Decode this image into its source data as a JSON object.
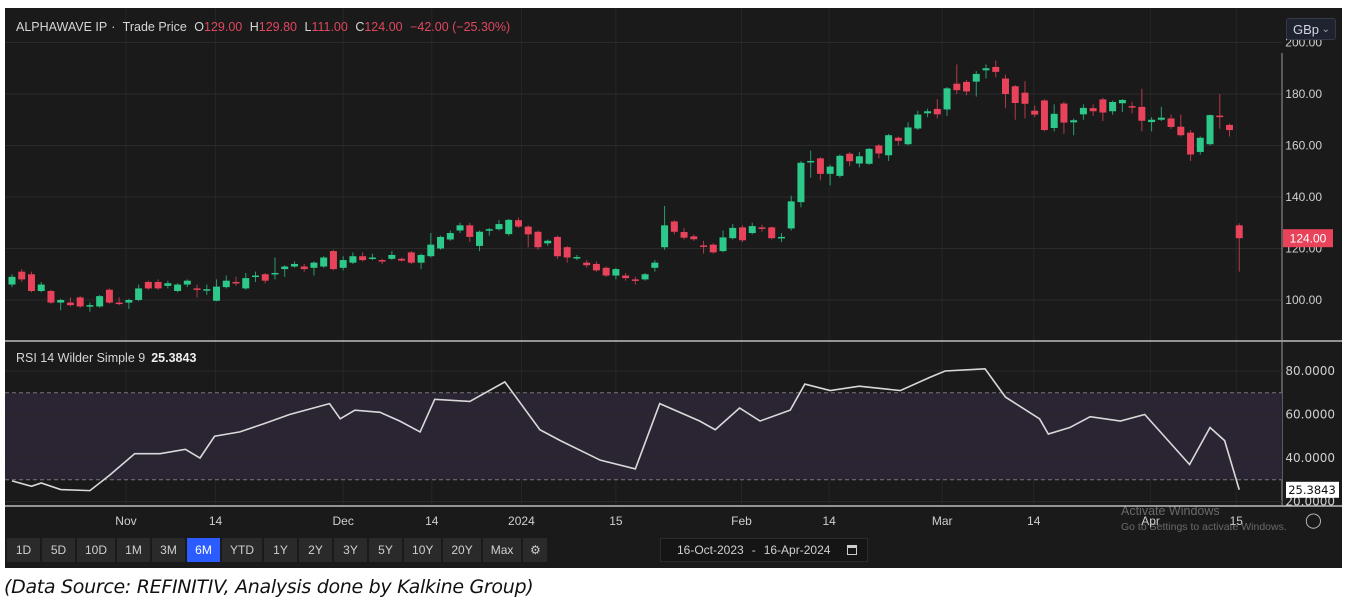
{
  "legend": {
    "instrument": "ALPHAWAVE IP",
    "series": "Trade Price",
    "open_label": "O",
    "open": "129.00",
    "high_label": "H",
    "high": "129.80",
    "low_label": "L",
    "low": "111.00",
    "close_label": "C",
    "close": "124.00",
    "change": "−42.00 (−25.30%)"
  },
  "currency": "GBp",
  "colors": {
    "up": "#2dc98a",
    "down": "#e8435a",
    "rsi": "#d9d9d9",
    "band": "#2a2433",
    "active": "#2b5cff"
  },
  "price_axis": {
    "ticks": [
      100,
      120,
      140,
      160,
      180,
      200
    ],
    "labels": [
      "100.00",
      "120.00",
      "140.00",
      "160.00",
      "180.00",
      "200.00"
    ],
    "range": [
      100,
      200
    ],
    "last_price_label": "124.00",
    "last_price": 124
  },
  "candles": [
    [
      106,
      110,
      105,
      109
    ],
    [
      111,
      112,
      107,
      108
    ],
    [
      110,
      111,
      103,
      103.5
    ],
    [
      103.5,
      107,
      103,
      106
    ],
    [
      103.5,
      104,
      98.5,
      99
    ],
    [
      99,
      100.5,
      96,
      100
    ],
    [
      99,
      101,
      97.5,
      98
    ],
    [
      101,
      101.5,
      97,
      97.5
    ],
    [
      97.5,
      99,
      95.5,
      98
    ],
    [
      97.5,
      102,
      97,
      101.5
    ],
    [
      104,
      104.5,
      98.5,
      99
    ],
    [
      99,
      101,
      98,
      98.5
    ],
    [
      99,
      100.5,
      96.5,
      100
    ],
    [
      100,
      106,
      99.5,
      104.5
    ],
    [
      107,
      107.5,
      104,
      104.5
    ],
    [
      107,
      108,
      104,
      104.5
    ],
    [
      105.5,
      107.5,
      104.5,
      106.5
    ],
    [
      103.5,
      106.5,
      103,
      106
    ],
    [
      106,
      108,
      105,
      107.5
    ],
    [
      104.5,
      106,
      101,
      104
    ],
    [
      104,
      106,
      102,
      104.2
    ],
    [
      99.7,
      108,
      99.5,
      105.2
    ],
    [
      105,
      109.5,
      104.5,
      107.5
    ],
    [
      107,
      109,
      105.5,
      106.5
    ],
    [
      104.5,
      110.5,
      104,
      108.5
    ],
    [
      109,
      111,
      107,
      109.5
    ],
    [
      110,
      110.5,
      106.5,
      107.5
    ],
    [
      110.3,
      116.5,
      108,
      110.5
    ],
    [
      112,
      113.5,
      109,
      113
    ],
    [
      113,
      115,
      112.5,
      114
    ],
    [
      113,
      114,
      111,
      112
    ],
    [
      112.5,
      115,
      109.5,
      114.5
    ],
    [
      113,
      117,
      112.5,
      116.5
    ],
    [
      119,
      119.5,
      111.5,
      112
    ],
    [
      112.5,
      117,
      111.5,
      115.5
    ],
    [
      114.5,
      118.5,
      114,
      117
    ],
    [
      117,
      118.5,
      115,
      115.5
    ],
    [
      116,
      118,
      115.5,
      116.5
    ],
    [
      115.5,
      116,
      114,
      115
    ],
    [
      116,
      119,
      115.5,
      117.5
    ],
    [
      116,
      116.5,
      115,
      115.3
    ],
    [
      118.5,
      119,
      114,
      114.5
    ],
    [
      114.5,
      118,
      112,
      117.5
    ],
    [
      117,
      126,
      116.5,
      121.5
    ],
    [
      120,
      125,
      119.5,
      124.5
    ],
    [
      123.5,
      127,
      123,
      126
    ],
    [
      127,
      130,
      126,
      129
    ],
    [
      129,
      130,
      122.5,
      124.5
    ],
    [
      121,
      127,
      119,
      126.5
    ],
    [
      127,
      128,
      125,
      127.5
    ],
    [
      127.5,
      131,
      127,
      129.5
    ],
    [
      125.6,
      131.5,
      125,
      131.1
    ],
    [
      131,
      132,
      128,
      128.5
    ],
    [
      128.5,
      129,
      120.5,
      125.5
    ],
    [
      126.5,
      127,
      119.5,
      120.5
    ],
    [
      122,
      123.5,
      121,
      123
    ],
    [
      124.5,
      125,
      116,
      117
    ],
    [
      120.5,
      121,
      114.5,
      116.5
    ],
    [
      116.5,
      117.5,
      115.5,
      116.7
    ],
    [
      114.5,
      115.5,
      112.5,
      113.5
    ],
    [
      114,
      115,
      111,
      111.5
    ],
    [
      112.5,
      113,
      109,
      109.5
    ],
    [
      109.5,
      112.5,
      108,
      112
    ],
    [
      109.5,
      110.5,
      107.5,
      108.5
    ],
    [
      108,
      109,
      106,
      107.5
    ],
    [
      108,
      110.5,
      107.5,
      110
    ],
    [
      112.5,
      115.5,
      111,
      114.5
    ],
    [
      120.5,
      136.5,
      119.5,
      129
    ],
    [
      130.5,
      131,
      125.5,
      126.5
    ],
    [
      126.4,
      128,
      123.5,
      124.2
    ],
    [
      124.7,
      125.5,
      123,
      123.6
    ],
    [
      121.2,
      123,
      118,
      121
    ],
    [
      121.5,
      122,
      118,
      118.5
    ],
    [
      119,
      127,
      118.5,
      124.3
    ],
    [
      124,
      129.5,
      123.5,
      128
    ],
    [
      128.2,
      129,
      122.5,
      123.2
    ],
    [
      126,
      130,
      125.5,
      128.7
    ],
    [
      128.2,
      129.2,
      126.5,
      128
    ],
    [
      128.2,
      128.5,
      123.5,
      124
    ],
    [
      124.2,
      126,
      122.5,
      124.5
    ],
    [
      127.8,
      140.5,
      127,
      138.3
    ],
    [
      138,
      154,
      136,
      153.3
    ],
    [
      153.8,
      158,
      147.5,
      154
    ],
    [
      155,
      155.5,
      146.5,
      149
    ],
    [
      149,
      152.5,
      144.5,
      151.8
    ],
    [
      148.2,
      156.5,
      147.5,
      156
    ],
    [
      156.8,
      157.5,
      152,
      153.9
    ],
    [
      153,
      157.5,
      151.5,
      155.8
    ],
    [
      152.9,
      159,
      152.5,
      158.7
    ],
    [
      160,
      160.5,
      155,
      156.9
    ],
    [
      156.2,
      164.5,
      154,
      164
    ],
    [
      163,
      163.5,
      160,
      161.8
    ],
    [
      160.5,
      169,
      160,
      167
    ],
    [
      166.6,
      173.5,
      166,
      172
    ],
    [
      172.5,
      174.3,
      171,
      173.3
    ],
    [
      174.2,
      178,
      170.5,
      172.1
    ],
    [
      174,
      182.7,
      171.5,
      182.2
    ],
    [
      184,
      191.5,
      180,
      181.5
    ],
    [
      184.7,
      185.5,
      179.5,
      181
    ],
    [
      184.8,
      189,
      179,
      187.8
    ],
    [
      189.2,
      191.5,
      186,
      190
    ],
    [
      190.5,
      193,
      186.5,
      188.6
    ],
    [
      186,
      187.5,
      174.5,
      180
    ],
    [
      183,
      183.5,
      170,
      176.5
    ],
    [
      180.5,
      185,
      170.5,
      176.2
    ],
    [
      173.5,
      175.5,
      171,
      172
    ],
    [
      177.5,
      178,
      165.5,
      166
    ],
    [
      166.8,
      176,
      165.5,
      172.3
    ],
    [
      176.3,
      177,
      164.5,
      168.9
    ],
    [
      169,
      170.5,
      164,
      169.8
    ],
    [
      172.1,
      176,
      170,
      174.6
    ],
    [
      174.5,
      176,
      171.5,
      173.3
    ],
    [
      177.9,
      178.5,
      169.5,
      172.8
    ],
    [
      173.3,
      177.5,
      172,
      176.9
    ],
    [
      176.4,
      178,
      173,
      177.7
    ],
    [
      175.3,
      177,
      172.5,
      175.1
    ],
    [
      175,
      182,
      165.5,
      169.6
    ],
    [
      169.1,
      171,
      165.5,
      170
    ],
    [
      170,
      175,
      169.5,
      170.8
    ],
    [
      170.5,
      172,
      166.5,
      167.2
    ],
    [
      167.3,
      172,
      163.5,
      164
    ],
    [
      165,
      166,
      154,
      156.5
    ],
    [
      157.5,
      163.5,
      156.5,
      163
    ],
    [
      160.5,
      172,
      160,
      171.8
    ],
    [
      171.6,
      180,
      166.5,
      171.4
    ],
    [
      168,
      168.5,
      163.5,
      166
    ],
    [
      129,
      129.8,
      111,
      124
    ]
  ],
  "rsi": {
    "label": "RSI 14 Wilder Simple 9",
    "value": "25.3843",
    "axis_labels": [
      "20.0000",
      "40.0000",
      "60.0000",
      "80.0000"
    ],
    "axis_ticks": [
      20,
      40,
      60,
      80
    ],
    "band": [
      30,
      70
    ],
    "points": [
      [
        0,
        29.5
      ],
      [
        2,
        27
      ],
      [
        3,
        28.5
      ],
      [
        5,
        25.5
      ],
      [
        8,
        25
      ],
      [
        10,
        32
      ],
      [
        12.6,
        42
      ],
      [
        15.2,
        42
      ],
      [
        17.8,
        44
      ],
      [
        19.3,
        40
      ],
      [
        20.8,
        50
      ],
      [
        23.4,
        52
      ],
      [
        26,
        56
      ],
      [
        28.5,
        60
      ],
      [
        32.6,
        65
      ],
      [
        33.7,
        58
      ],
      [
        35.2,
        62
      ],
      [
        37.8,
        61
      ],
      [
        39.8,
        57
      ],
      [
        41.9,
        52
      ],
      [
        43.4,
        67
      ],
      [
        47,
        66
      ],
      [
        50.6,
        75
      ],
      [
        54.2,
        53
      ],
      [
        56.3,
        48
      ],
      [
        60.4,
        39
      ],
      [
        64,
        35
      ],
      [
        66.5,
        65
      ],
      [
        70.6,
        57
      ],
      [
        72.2,
        53
      ],
      [
        74.7,
        63
      ],
      [
        76.8,
        57
      ],
      [
        79.9,
        62
      ],
      [
        81.4,
        74
      ],
      [
        84,
        71
      ],
      [
        87,
        73
      ],
      [
        91.2,
        71
      ],
      [
        94.2,
        77
      ],
      [
        95.8,
        80
      ],
      [
        99.9,
        81
      ],
      [
        102,
        68
      ],
      [
        105.5,
        58
      ],
      [
        106.4,
        51
      ],
      [
        108.6,
        54
      ],
      [
        110.7,
        59
      ],
      [
        113.8,
        57
      ],
      [
        116.3,
        60
      ],
      [
        117.9,
        52
      ],
      [
        120.9,
        37
      ],
      [
        123,
        54
      ],
      [
        124.5,
        48
      ],
      [
        126,
        25.3843
      ]
    ]
  },
  "x_axis": {
    "labels": [
      {
        "text": "Nov",
        "i": 11.7
      },
      {
        "text": "14",
        "i": 20.9
      },
      {
        "text": "Dec",
        "i": 34
      },
      {
        "text": "14",
        "i": 43.1
      },
      {
        "text": "2024",
        "i": 52.3
      },
      {
        "text": "15",
        "i": 62
      },
      {
        "text": "Feb",
        "i": 74.9
      },
      {
        "text": "14",
        "i": 83.9
      },
      {
        "text": "Mar",
        "i": 95.5
      },
      {
        "text": "14",
        "i": 104.9
      },
      {
        "text": "Apr",
        "i": 116.9
      },
      {
        "text": "15",
        "i": 125.7
      }
    ]
  },
  "toolbar": {
    "ranges": [
      "1D",
      "5D",
      "10D",
      "1M",
      "3M",
      "6M",
      "YTD",
      "1Y",
      "2Y",
      "3Y",
      "5Y",
      "10Y",
      "20Y",
      "Max"
    ],
    "active": "6M"
  },
  "date_range": {
    "from": "16-Oct-2023",
    "separator": "-",
    "to": "16-Apr-2024"
  },
  "watermark": {
    "title": "Activate Windows",
    "subtitle": "Go to Settings to activate Windows."
  },
  "caption": "(Data Source: REFINITIV, Analysis done by Kalkine Group)"
}
